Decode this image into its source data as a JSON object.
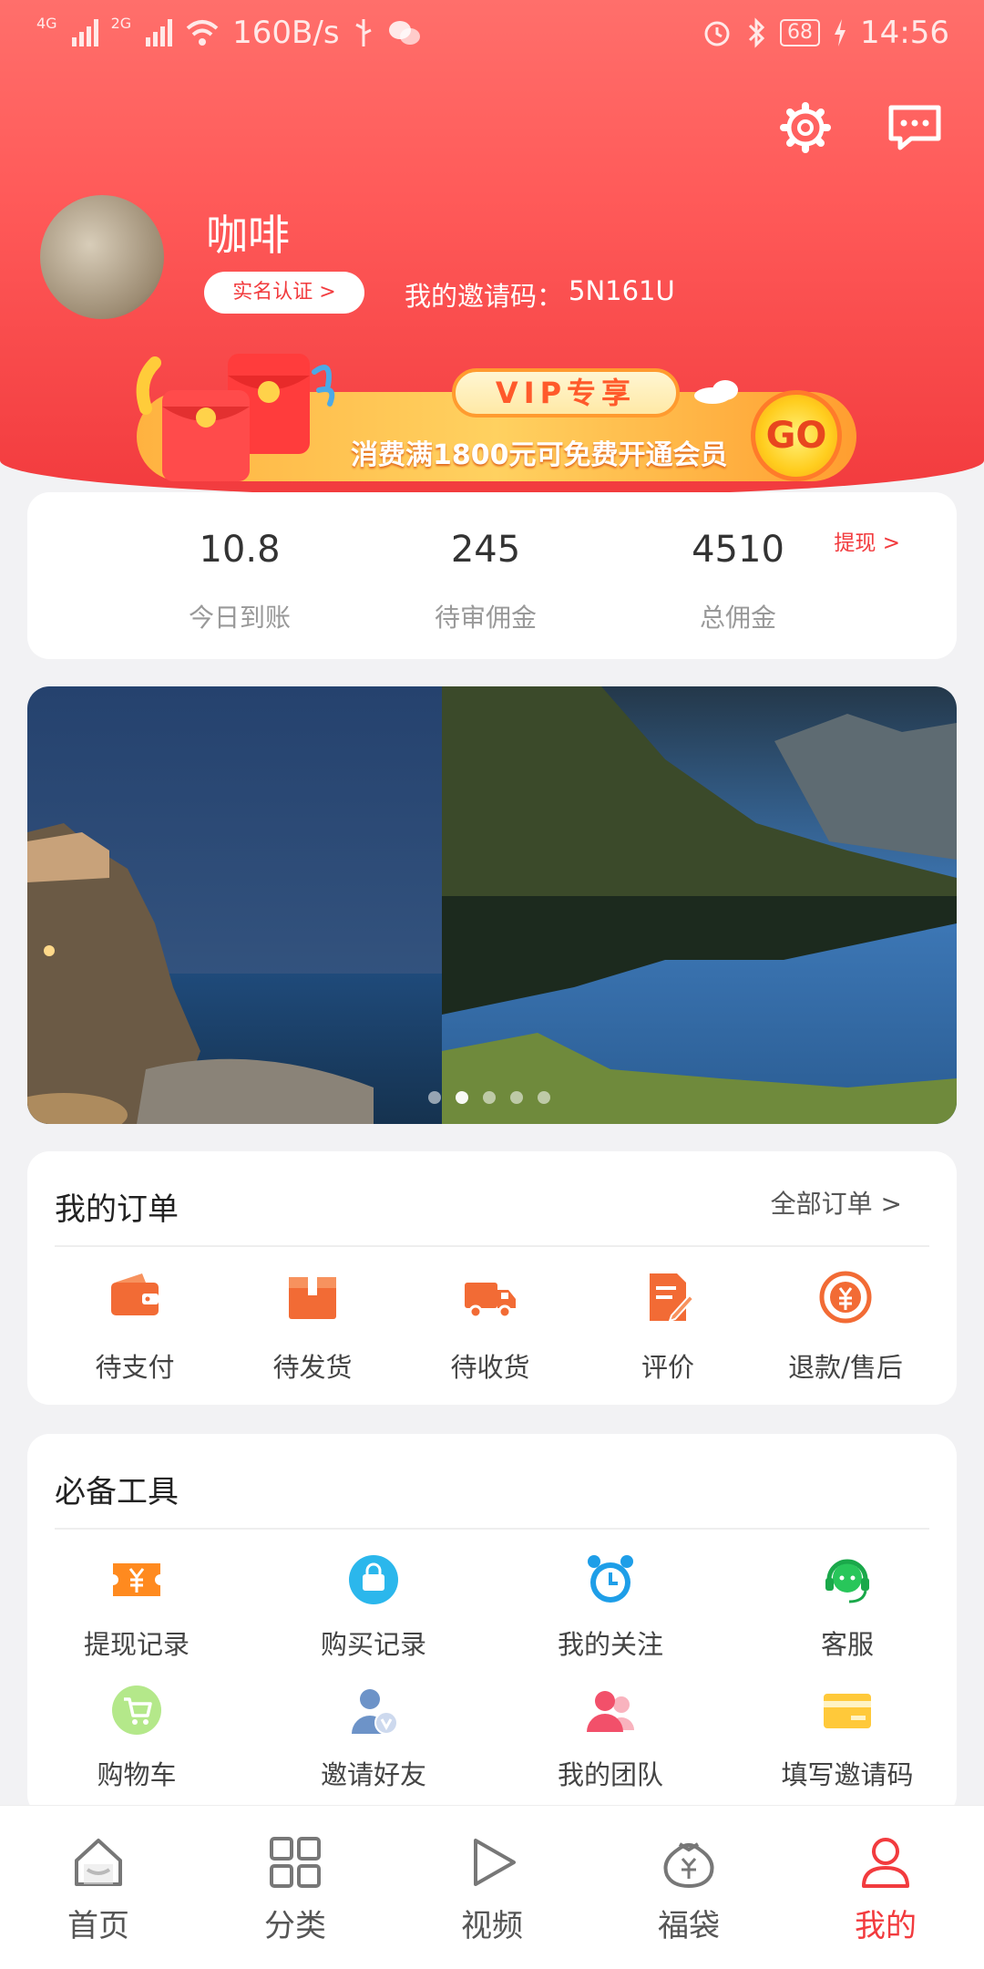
{
  "status_bar": {
    "network_1": "4G",
    "network_2": "2G",
    "speed": "160B/s",
    "battery": "68",
    "time": "14:56"
  },
  "profile": {
    "username": "咖啡",
    "verify_label": "实名认证 >",
    "invite_label": "我的邀请码：",
    "invite_code": "5N161U"
  },
  "vip_banner": {
    "badge": "VIP专享",
    "text": "消费满1800元可免费开通会员",
    "go": "GO"
  },
  "stats": {
    "withdraw": "提现 >",
    "items": [
      {
        "value": "10.8",
        "label": "今日到账"
      },
      {
        "value": "245",
        "label": "待审佣金"
      },
      {
        "value": "4510",
        "label": "总佣金"
      }
    ]
  },
  "carousel": {
    "dot_count": 5,
    "active_dot": 1
  },
  "orders": {
    "title": "我的订单",
    "all_link": "全部订单 >",
    "items": [
      {
        "label": "待支付",
        "icon": "wallet-icon"
      },
      {
        "label": "待发货",
        "icon": "package-icon"
      },
      {
        "label": "待收货",
        "icon": "truck-icon"
      },
      {
        "label": "评价",
        "icon": "edit-document-icon"
      },
      {
        "label": "退款/售后",
        "icon": "refund-icon"
      }
    ]
  },
  "tools": {
    "title": "必备工具",
    "items": [
      {
        "label": "提现记录",
        "icon": "withdraw-ticket-icon"
      },
      {
        "label": "购买记录",
        "icon": "shopping-bag-icon"
      },
      {
        "label": "我的关注",
        "icon": "alarm-clock-icon"
      },
      {
        "label": "客服",
        "icon": "headset-icon"
      },
      {
        "label": "购物车",
        "icon": "cart-icon"
      },
      {
        "label": "邀请好友",
        "icon": "invite-user-icon"
      },
      {
        "label": "我的团队",
        "icon": "team-icon"
      },
      {
        "label": "填写邀请码",
        "icon": "card-icon"
      }
    ]
  },
  "tabbar": {
    "items": [
      {
        "label": "首页",
        "icon": "home-icon"
      },
      {
        "label": "分类",
        "icon": "grid-icon"
      },
      {
        "label": "视频",
        "icon": "play-icon"
      },
      {
        "label": "福袋",
        "icon": "lucky-bag-icon"
      },
      {
        "label": "我的",
        "icon": "user-icon"
      }
    ],
    "active": "我的"
  },
  "colors": {
    "accent": "#f23b3e",
    "orange": "#f26b35"
  }
}
